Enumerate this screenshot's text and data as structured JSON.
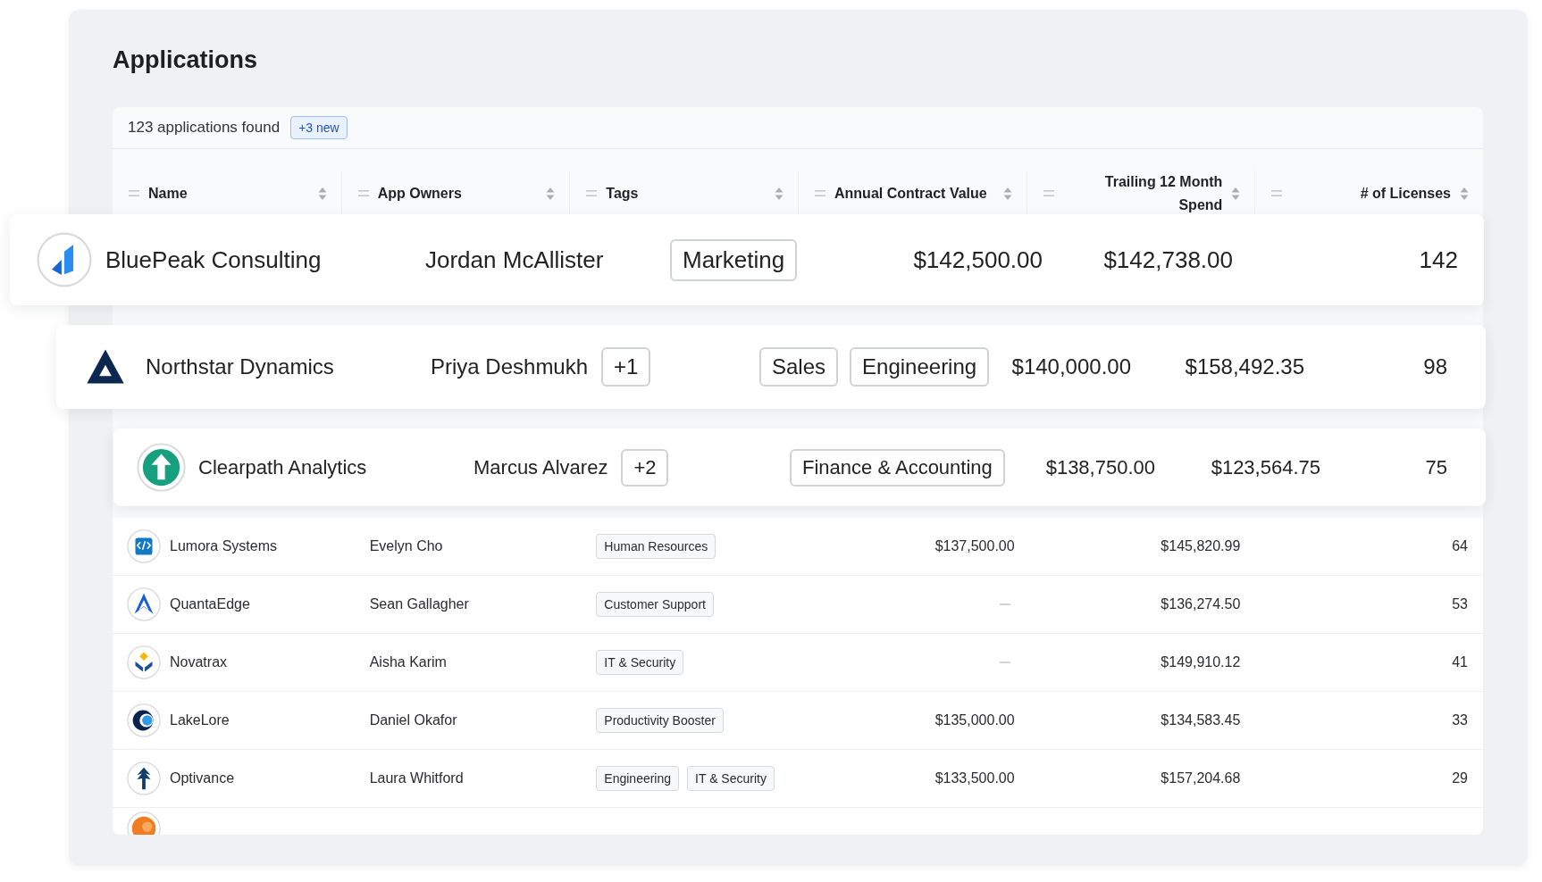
{
  "title": "Applications",
  "summary": {
    "count": "123 applications found",
    "badge": "+3 new"
  },
  "columns": [
    {
      "label": "Name"
    },
    {
      "label": "App Owners"
    },
    {
      "label": "Tags"
    },
    {
      "label": "Annual Contract Value"
    },
    {
      "label": "Trailing 12 Month Spend"
    },
    {
      "label": "# of Licenses"
    }
  ],
  "rows": [
    {
      "kind": "featured",
      "name": "BluePeak Consulting",
      "owner": "Jordan McAllister",
      "tags": [
        "Marketing"
      ],
      "annual_contract_value": "$142,500.00",
      "trailing_spend": "$142,738.00",
      "licenses": "142"
    },
    {
      "kind": "featured",
      "name": "Northstar Dynamics",
      "owner": "Priya Deshmukh",
      "extra_owners": "+1",
      "tags": [
        "Sales",
        "Engineering"
      ],
      "annual_contract_value": "$140,000.00",
      "trailing_spend": "$158,492.35",
      "licenses": "98"
    },
    {
      "kind": "featured",
      "name": "Clearpath Analytics",
      "owner": "Marcus Alvarez",
      "extra_owners": "+2",
      "tags": [
        "Finance & Accounting"
      ],
      "annual_contract_value": "$138,750.00",
      "trailing_spend": "$123,564.75",
      "licenses": "75"
    },
    {
      "kind": "standard",
      "name": "Lumora Systems",
      "owner": "Evelyn Cho",
      "tags": [
        "Human Resources"
      ],
      "annual_contract_value": "$137,500.00",
      "trailing_spend": "$145,820.99",
      "licenses": "64"
    },
    {
      "kind": "standard",
      "name": "QuantaEdge",
      "owner": "Sean Gallagher",
      "tags": [
        "Customer Support"
      ],
      "annual_contract_value": null,
      "trailing_spend": "$136,274.50",
      "licenses": "53"
    },
    {
      "kind": "standard",
      "name": "Novatrax",
      "owner": "Aisha Karim",
      "tags": [
        "IT & Security"
      ],
      "annual_contract_value": null,
      "trailing_spend": "$149,910.12",
      "licenses": "41"
    },
    {
      "kind": "standard",
      "name": "LakeLore",
      "owner": "Daniel Okafor",
      "tags": [
        "Productivity Booster"
      ],
      "annual_contract_value": "$135,000.00",
      "trailing_spend": "$134,583.45",
      "licenses": "33"
    },
    {
      "kind": "standard",
      "name": "Optivance",
      "owner": "Laura Whitford",
      "tags": [
        "Engineering",
        "IT & Security"
      ],
      "annual_contract_value": "$133,500.00",
      "trailing_spend": "$157,204.68",
      "licenses": "29"
    }
  ]
}
